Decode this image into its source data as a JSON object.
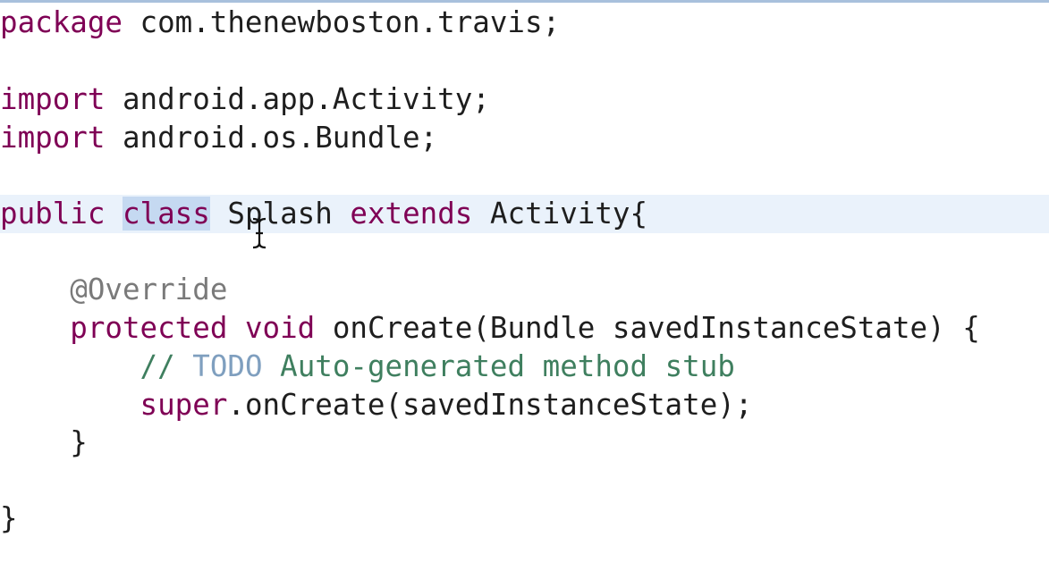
{
  "code": {
    "line1": {
      "kw": "package",
      "text": " com.thenewboston.travis;"
    },
    "line3": {
      "kw": "import",
      "text": " android.app.Activity;"
    },
    "line4": {
      "kw": "import",
      "text": " android.os.Bundle;"
    },
    "line6": {
      "kw_public": "public",
      "kw_class": "class",
      "name": "Splash",
      "kw_extends": "extends",
      "parent": "Activity{"
    },
    "line8": {
      "annotation": "@Override"
    },
    "line9": {
      "kw_protected": "protected",
      "kw_void": "void",
      "text": "onCreate(Bundle savedInstanceState) {"
    },
    "line10": {
      "slashes": "//",
      "todo": "TODO",
      "comment": "Auto-generated method stub"
    },
    "line11": {
      "kw_super": "super",
      "text": ".onCreate(savedInstanceState);"
    },
    "line12": {
      "brace": "}"
    },
    "line14": {
      "brace": "}"
    }
  },
  "colors": {
    "keyword": "#7f0055",
    "annotation": "#7a7a7a",
    "comment": "#3f7f5f",
    "todo": "#7f9fbf",
    "current_line": "#eaf2fb",
    "selection": "#c5d9f1"
  },
  "icons": {
    "cursor": "text-cursor-icon"
  }
}
